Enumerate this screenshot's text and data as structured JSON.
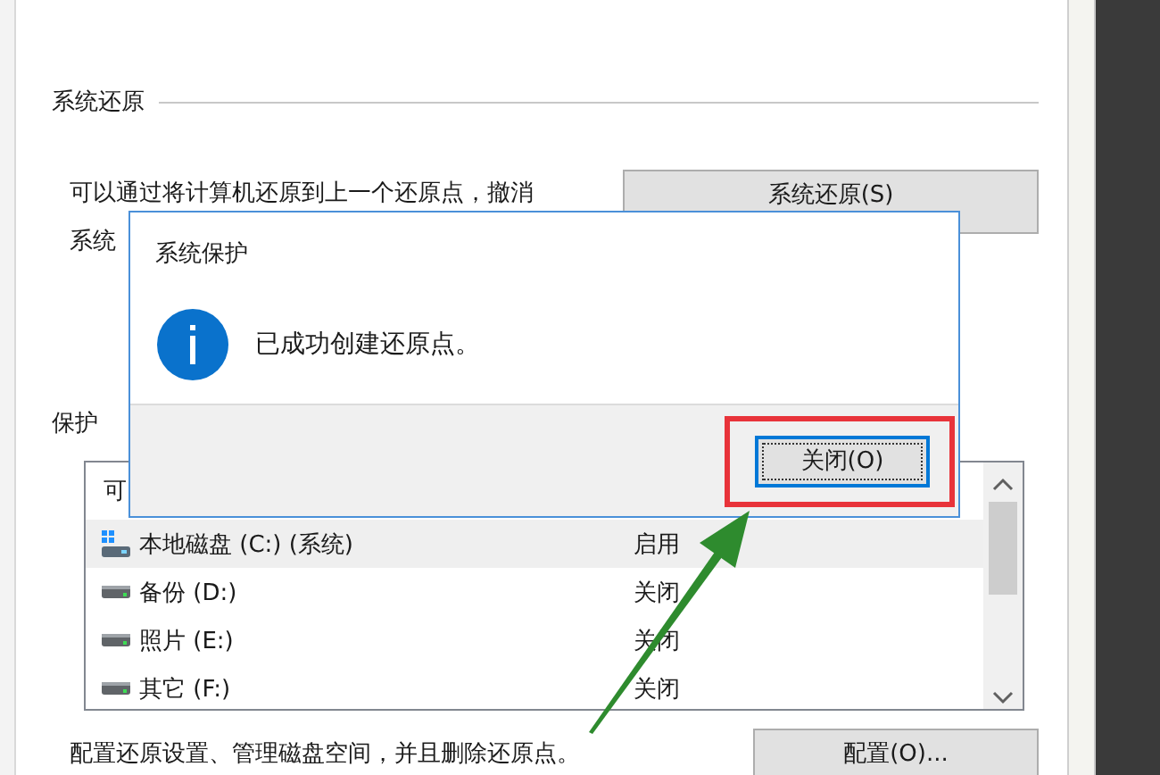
{
  "background_dialog": {
    "restore_section": {
      "heading": "系统还原",
      "description_lines": [
        "可以通过将计算机还原到上一个还原点，撤消",
        "系统"
      ],
      "button": "系统还原(S)"
    },
    "protection_section": {
      "heading": "保护",
      "column_1": "可",
      "drives": [
        {
          "name": "本地磁盘 (C:) (系统)",
          "status": "启用",
          "kind": "system",
          "selected": true
        },
        {
          "name": "备份 (D:)",
          "status": "关闭",
          "kind": "data",
          "selected": false
        },
        {
          "name": "照片 (E:)",
          "status": "关闭",
          "kind": "data",
          "selected": false
        },
        {
          "name": "其它 (F:)",
          "status": "关闭",
          "kind": "data",
          "selected": false
        }
      ],
      "configure_text": "配置还原设置、管理磁盘空间，并且删除还原点。",
      "configure_button": "配置(O)..."
    }
  },
  "message_box": {
    "title": "系统保护",
    "message": "已成功创建还原点。",
    "button": "关闭(O)",
    "button_focused": true
  }
}
